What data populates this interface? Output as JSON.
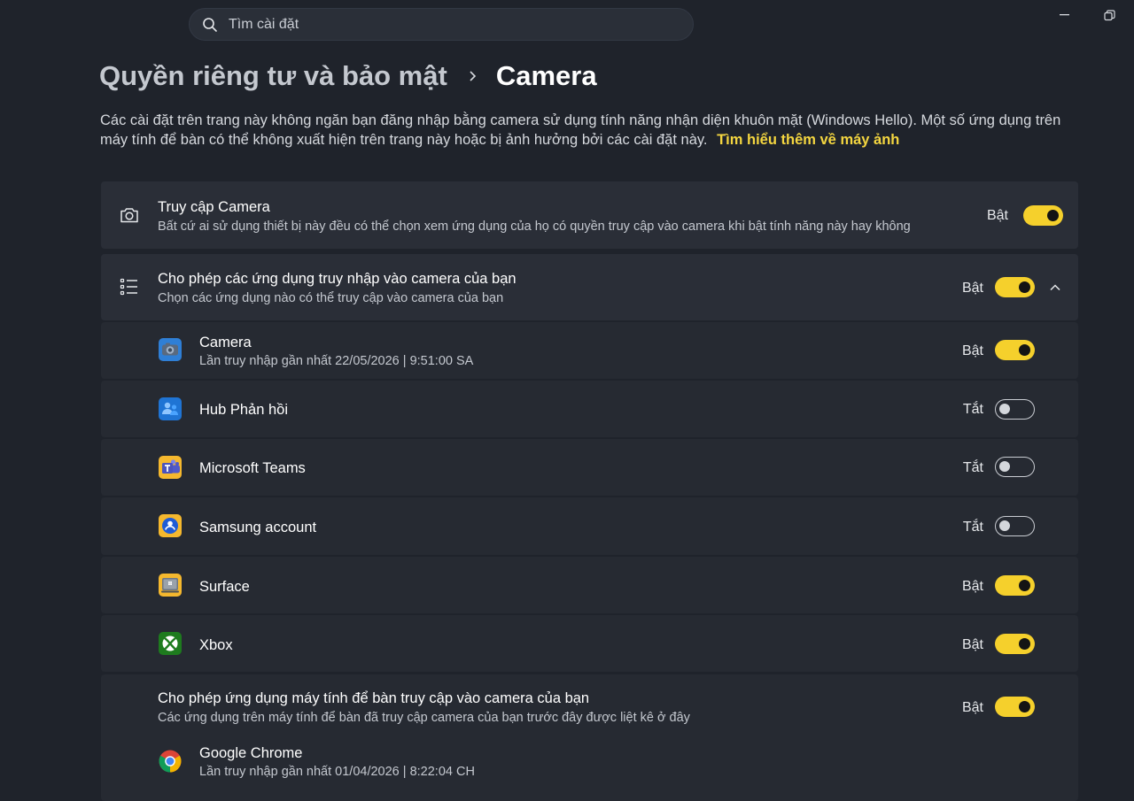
{
  "search": {
    "placeholder": "Tìm cài đặt"
  },
  "breadcrumb": {
    "parent": "Quyền riêng tư và bảo mật",
    "current": "Camera"
  },
  "description": {
    "text": "Các cài đặt trên trang này không ngăn bạn đăng nhập bằng camera sử dụng tính năng nhận diện khuôn mặt (Windows Hello). Một số ứng dụng trên máy tính để bàn có thể không xuất hiện trên trang này hoặc bị ảnh hưởng bởi các cài đặt này.",
    "link": "Tìm hiểu thêm về máy ảnh"
  },
  "camera_access": {
    "title": "Truy cập Camera",
    "subtitle": "Bất cứ ai sử dụng thiết bị này đều có thể chọn xem ứng dụng của họ có quyền truy cập vào camera khi bật tính năng này hay không",
    "state": "Bật",
    "enabled": true,
    "icon": "camera-icon"
  },
  "app_access": {
    "title": "Cho phép các ứng dụng truy nhập vào camera của bạn",
    "subtitle": "Chọn các ứng dụng nào có thể truy cập vào camera của bạn",
    "state": "Bật",
    "enabled": true,
    "icon": "list-icon",
    "expanded": true
  },
  "apps": [
    {
      "name": "Camera",
      "sub": "Lần truy nhập gần nhất 22/05/2026  |  9:51:00 SA",
      "state": "Bật",
      "enabled": true,
      "icon": "camera-app-icon"
    },
    {
      "name": "Hub Phản hồi",
      "sub": "",
      "state": "Tắt",
      "enabled": false,
      "icon": "feedback-hub-icon"
    },
    {
      "name": "Microsoft Teams",
      "sub": "",
      "state": "Tắt",
      "enabled": false,
      "icon": "teams-icon"
    },
    {
      "name": "Samsung account",
      "sub": "",
      "state": "Tắt",
      "enabled": false,
      "icon": "samsung-account-icon"
    },
    {
      "name": "Surface",
      "sub": "",
      "state": "Bật",
      "enabled": true,
      "icon": "surface-icon"
    },
    {
      "name": "Xbox",
      "sub": "",
      "state": "Bật",
      "enabled": true,
      "icon": "xbox-icon"
    }
  ],
  "desktop_access": {
    "title": "Cho phép ứng dụng máy tính để bàn truy cập vào camera của bạn",
    "subtitle": "Các ứng dụng trên máy tính để bàn đã truy cập camera của bạn trước đây được liệt kê ở đây",
    "state": "Bật",
    "enabled": true,
    "apps": [
      {
        "name": "Google Chrome",
        "sub": "Lần truy nhập gần nhất 01/04/2026  |  8:22:04 CH",
        "icon": "chrome-icon"
      }
    ]
  },
  "colors": {
    "accent": "#f5d02c",
    "link": "#f4d640",
    "background": "#1f232b",
    "card": "#2a2e37"
  }
}
